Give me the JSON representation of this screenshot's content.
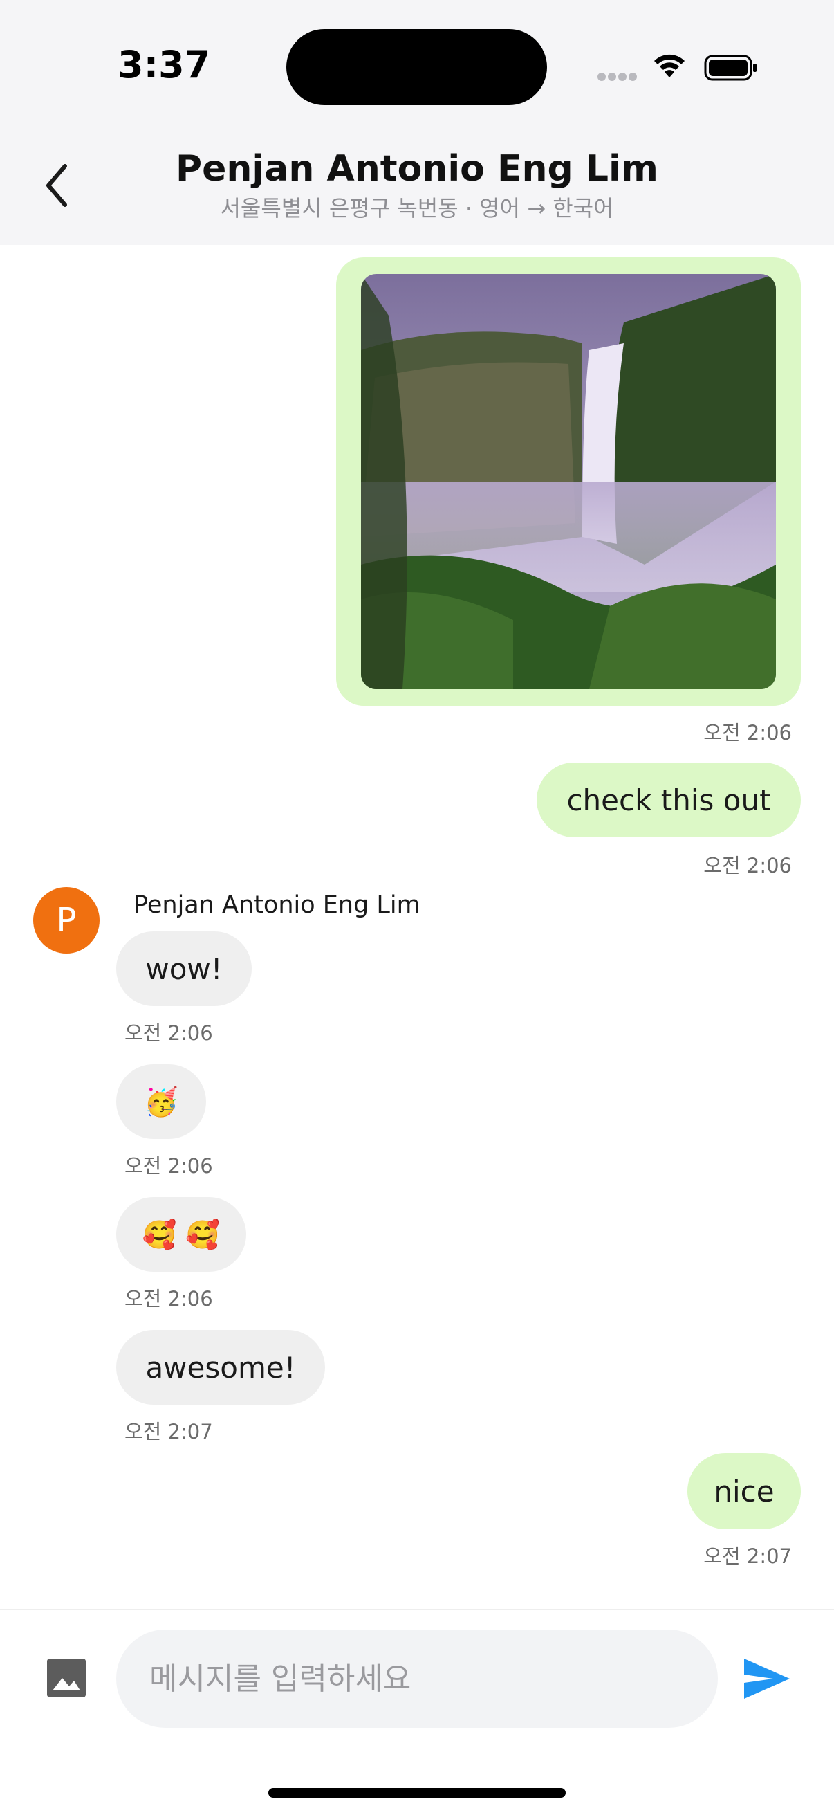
{
  "status_bar": {
    "time": "3:37"
  },
  "header": {
    "title": "Penjan Antonio Eng Lim",
    "subtitle": "서울특별시 은평구 녹번동 · 영어 → 한국어"
  },
  "messages": [
    {
      "type": "image",
      "direction": "out",
      "time": "오전 2:06"
    },
    {
      "type": "text",
      "direction": "out",
      "text": "check this out",
      "time": "오전 2:06"
    },
    {
      "type": "text",
      "direction": "in",
      "sender": "Penjan Antonio Eng Lim",
      "avatar_letter": "P",
      "text": "wow!",
      "time": "오전 2:06"
    },
    {
      "type": "emoji",
      "direction": "in",
      "text": "🥳",
      "time": "오전 2:06"
    },
    {
      "type": "emoji",
      "direction": "in",
      "text": "🥰 🥰",
      "time": "오전 2:06"
    },
    {
      "type": "text",
      "direction": "in",
      "text": "awesome!",
      "time": "오전 2:07"
    },
    {
      "type": "text",
      "direction": "out",
      "text": "nice",
      "time": "오전 2:07"
    }
  ],
  "composer": {
    "placeholder": "메시지를 입력하세요",
    "value": "",
    "image_icon": "image-icon",
    "send_icon": "send-icon"
  },
  "colors": {
    "outgoing_bubble": "#dcf8c6",
    "incoming_bubble": "#efefef",
    "avatar": "#f07010",
    "send": "#2196f3"
  }
}
